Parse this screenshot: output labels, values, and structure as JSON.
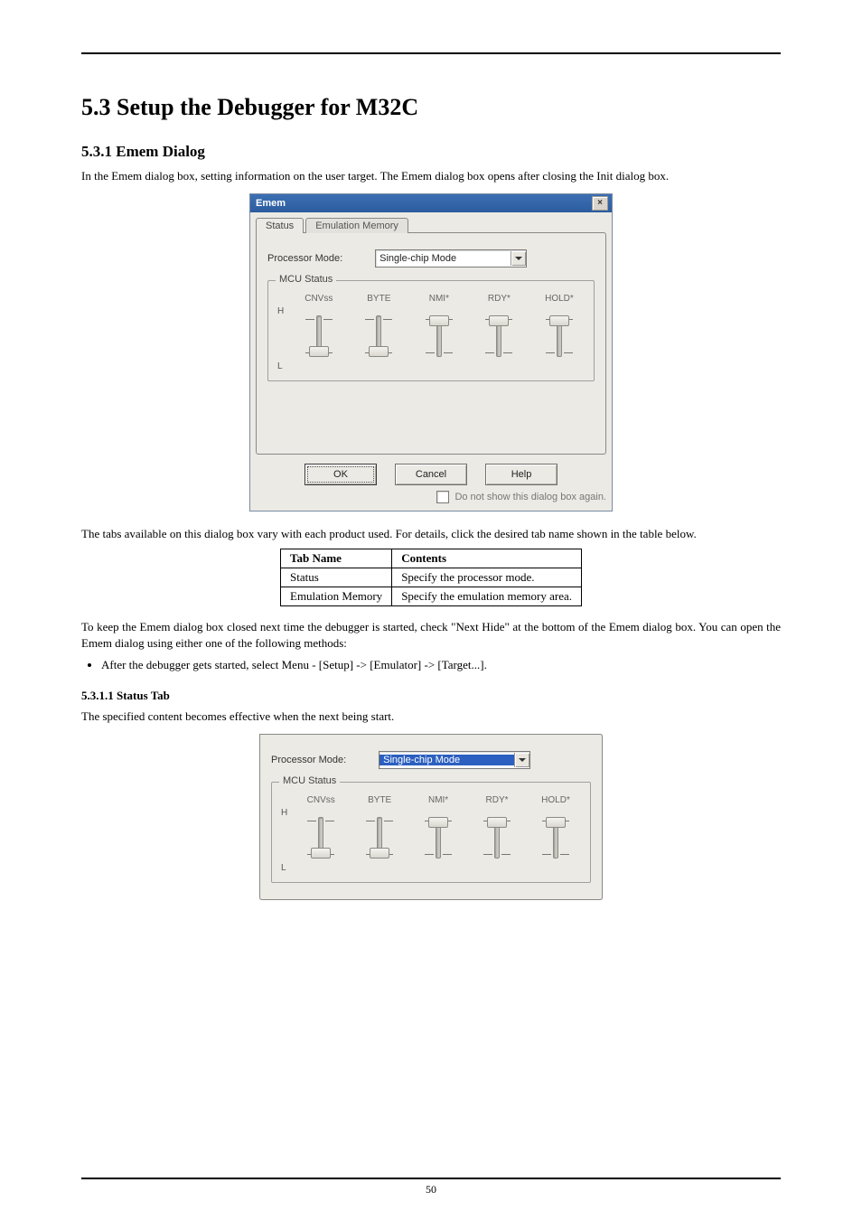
{
  "section": {
    "title": "5.3 Setup the Debugger for M32C",
    "sub1": {
      "heading": "5.3.1 Emem Dialog",
      "intro": "In the Emem dialog box, setting information on the user target. The Emem dialog box opens after closing the Init dialog box."
    },
    "tabs_para": "The tabs available on this dialog box vary with each product used. For details, click the desired tab name shown in the table below.",
    "table": {
      "headers": [
        "Tab Name",
        "Contents"
      ],
      "rows": [
        [
          "Status",
          "Specify the processor mode."
        ],
        [
          "Emulation Memory",
          "Specify the emulation memory area."
        ]
      ]
    },
    "keep_para": "To keep the Emem dialog box closed next time the debugger is started, check \"Next Hide\" at the bottom of the Emem dialog box. You can open the Emem dialog using either one of the following methods:",
    "bullet1": "After the debugger gets started, select Menu - [Setup] -> [Emulator] -> [Target...].",
    "statustab": {
      "heading": "5.3.1.1 Status Tab",
      "para": "The specified content becomes effective when the next being start."
    }
  },
  "dialog": {
    "title": "Emem",
    "close_x": "×",
    "tabs": {
      "status": "Status",
      "emulation": "Emulation Memory"
    },
    "proc_label": "Processor Mode:",
    "proc_value": "Single-chip Mode",
    "mcu_label": "MCU Status",
    "mcu_headers": [
      "CNVss",
      "BYTE",
      "NMI*",
      "RDY*",
      "HOLD*"
    ],
    "side_h": "H",
    "side_l": "L",
    "dash": "-",
    "buttons": {
      "ok": "OK",
      "cancel": "Cancel",
      "help": "Help"
    },
    "check_label": "Do not show this dialog box again."
  },
  "page_number": "50"
}
